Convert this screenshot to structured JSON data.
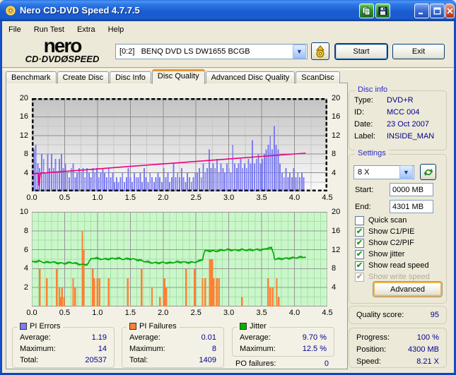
{
  "window": {
    "title": "Nero CD-DVD Speed 4.7.7.5"
  },
  "titlebar": {
    "buttons": [
      {
        "name": "copy-to-clipboard-button",
        "icon": "copy-icon"
      },
      {
        "name": "save-screenshot-button",
        "icon": "floppy-disk-icon"
      },
      {
        "name": "minimize-button",
        "icon": "minimize-icon"
      },
      {
        "name": "maximize-button",
        "icon": "maximize-icon"
      },
      {
        "name": "close-button",
        "icon": "close-icon"
      }
    ]
  },
  "menu": {
    "items": [
      "File",
      "Run Test",
      "Extra",
      "Help"
    ]
  },
  "header": {
    "logo_line1": "nero",
    "logo_line2": "CD·DVDØSPEED",
    "drive": "[0:2]   BENQ DVD LS DW1655 BCGB",
    "eject_icon": "eject-disc-icon",
    "start_label": "Start",
    "exit_label": "Exit"
  },
  "tabs": {
    "items": [
      "Benchmark",
      "Create Disc",
      "Disc Info",
      "Disc Quality",
      "Advanced Disc Quality",
      "ScanDisc"
    ],
    "active": "Disc Quality"
  },
  "disc_info": {
    "title": "Disc info",
    "rows": [
      {
        "label": "Type:",
        "value": "DVD+R"
      },
      {
        "label": "ID:",
        "value": "MCC 004"
      },
      {
        "label": "Date:",
        "value": "23 Oct 2007"
      },
      {
        "label": "Label:",
        "value": "INSIDE_MAN"
      }
    ]
  },
  "settings": {
    "title": "Settings",
    "speed": "8 X",
    "refresh_icon": "refresh-icon",
    "start_label": "Start:",
    "start_value": "0000 MB",
    "end_label": "End:",
    "end_value": "4301 MB",
    "checkboxes": [
      {
        "label": "Quick scan",
        "checked": false,
        "disabled": false
      },
      {
        "label": "Show C1/PIE",
        "checked": true,
        "disabled": false
      },
      {
        "label": "Show C2/PIF",
        "checked": true,
        "disabled": false
      },
      {
        "label": "Show jitter",
        "checked": true,
        "disabled": false
      },
      {
        "label": "Show read speed",
        "checked": true,
        "disabled": false
      },
      {
        "label": "Show write speed",
        "checked": true,
        "disabled": true
      }
    ],
    "advanced_label": "Advanced"
  },
  "quality": {
    "label": "Quality score:",
    "value": "95"
  },
  "progress": {
    "rows": [
      {
        "label": "Progress:",
        "value": "100 %"
      },
      {
        "label": "Position:",
        "value": "4300 MB"
      },
      {
        "label": "Speed:",
        "value": "8.21 X"
      }
    ]
  },
  "stats": {
    "boxes": [
      {
        "title": "PI Errors",
        "color": "#7d7df2",
        "rows": [
          {
            "label": "Average:",
            "value": "1.19"
          },
          {
            "label": "Maximum:",
            "value": "14"
          },
          {
            "label": "Total:",
            "value": "20537"
          }
        ]
      },
      {
        "title": "PI Failures",
        "color": "#ff8033",
        "rows": [
          {
            "label": "Average:",
            "value": "0.01"
          },
          {
            "label": "Maximum:",
            "value": "8"
          },
          {
            "label": "Total:",
            "value": "1409"
          }
        ]
      },
      {
        "title": "Jitter",
        "color": "#00b400",
        "rows": [
          {
            "label": "Average:",
            "value": "9.70 %"
          },
          {
            "label": "Maximum:",
            "value": "12.5 %"
          }
        ]
      }
    ],
    "po_label": "PO failures:",
    "po_value": "0"
  },
  "chart_data": [
    {
      "type": "bar",
      "name": "pi-errors-and-read-speed",
      "x_axis": {
        "range": [
          0,
          4.5
        ],
        "tick_step": 0.5,
        "tick_labels": [
          "0.0",
          "0.5",
          "1.0",
          "1.5",
          "2.0",
          "2.5",
          "3.0",
          "3.5",
          "4.0",
          "4.5"
        ]
      },
      "y_axis_left": {
        "range": [
          0,
          20
        ],
        "ticks": [
          {
            "v": 4,
            "t": "4"
          },
          {
            "v": 8,
            "t": "8"
          },
          {
            "v": 12,
            "t": "12"
          },
          {
            "v": 16,
            "t": "16"
          },
          {
            "v": 20,
            "t": "20"
          }
        ]
      },
      "y_axis_right": {
        "range": [
          0,
          20
        ],
        "ticks": [
          {
            "v": 4,
            "t": "4"
          },
          {
            "v": 8,
            "t": "8"
          },
          {
            "v": 12,
            "t": "12"
          },
          {
            "v": 16,
            "t": "16"
          },
          {
            "v": 20,
            "t": "20"
          }
        ]
      },
      "background": {
        "type": "gradient",
        "from": "#c3c3c3",
        "to": "#fbfbfb"
      },
      "series": [
        {
          "name": "PI Errors",
          "type": "bar",
          "color": "#7d7df2",
          "x_start": 0,
          "x_step": 0.03,
          "values": [
            5,
            9,
            10,
            6,
            5,
            8,
            7,
            4,
            8,
            5,
            8,
            5,
            7,
            4,
            7,
            8,
            5,
            6,
            4,
            3,
            5,
            6,
            3,
            4,
            5,
            4,
            5,
            3,
            5,
            4,
            3,
            5,
            4,
            5,
            3,
            4,
            5,
            4,
            3,
            5,
            3,
            4,
            2,
            3,
            2,
            3,
            4,
            2,
            3,
            5,
            3,
            2,
            4,
            3,
            3,
            4,
            2,
            5,
            3,
            2,
            4,
            3,
            2,
            3,
            4,
            3,
            2,
            5,
            3,
            4,
            2,
            3,
            6,
            3,
            4,
            3,
            5,
            3,
            2,
            4,
            3,
            2,
            3,
            4,
            4,
            5,
            3,
            6,
            4,
            5,
            9,
            5,
            6,
            5,
            7,
            4,
            6,
            5,
            4,
            6,
            5,
            4,
            10,
            6,
            5,
            6,
            7,
            5,
            6,
            5,
            7,
            6,
            11,
            6,
            7,
            8,
            6,
            7,
            8,
            9,
            10,
            12,
            9,
            14,
            10,
            9,
            6,
            4,
            3,
            5,
            3,
            4,
            3,
            5,
            3,
            4,
            3,
            4,
            3
          ]
        },
        {
          "name": "Read speed",
          "type": "line",
          "color": "#ee0080",
          "points": [
            [
              0,
              3.75
            ],
            [
              0.1,
              3.86
            ],
            [
              0.11,
              1.2
            ],
            [
              0.13,
              3.9
            ],
            [
              0.5,
              4.29
            ],
            [
              1,
              4.82
            ],
            [
              1.5,
              5.36
            ],
            [
              2,
              5.89
            ],
            [
              2.5,
              6.43
            ],
            [
              3,
              6.96
            ],
            [
              3.5,
              7.5
            ],
            [
              3.7,
              7.71
            ],
            [
              4,
              8.03
            ],
            [
              4.17,
              8.2
            ]
          ]
        }
      ]
    },
    {
      "type": "line",
      "name": "jitter-and-pi-failures",
      "x_axis": {
        "range": [
          0,
          4.5
        ],
        "tick_step": 0.5,
        "tick_labels": [
          "0.0",
          "0.5",
          "1.0",
          "1.5",
          "2.0",
          "2.5",
          "3.0",
          "3.5",
          "4.0",
          "4.5"
        ]
      },
      "y_axis_left": {
        "range": [
          0,
          10
        ],
        "ticks": [
          {
            "v": 2,
            "t": "2"
          },
          {
            "v": 4,
            "t": "4"
          },
          {
            "v": 6,
            "t": "6"
          },
          {
            "v": 8,
            "t": "8"
          },
          {
            "v": 10,
            "t": "10"
          }
        ]
      },
      "y_axis_right": {
        "range": [
          0,
          20
        ],
        "ticks": [
          {
            "v": 4,
            "t": "4"
          },
          {
            "v": 8,
            "t": "8"
          },
          {
            "v": 12,
            "t": "12"
          },
          {
            "v": 16,
            "t": "16"
          },
          {
            "v": 20,
            "t": "20"
          }
        ]
      },
      "background": {
        "type": "solid",
        "color": "#c9f7c9"
      },
      "series": [
        {
          "name": "PI Failures",
          "type": "spike",
          "color": "#ff8033",
          "points": [
            [
              0.12,
              4
            ],
            [
              0.23,
              3
            ],
            [
              0.38,
              4
            ],
            [
              0.42,
              2
            ],
            [
              0.44,
              1
            ],
            [
              0.46,
              2
            ],
            [
              0.49,
              1
            ],
            [
              0.63,
              3
            ],
            [
              0.66,
              2
            ],
            [
              0.77,
              8
            ],
            [
              0.79,
              6
            ],
            [
              0.93,
              4
            ],
            [
              0.95,
              3
            ],
            [
              1.0,
              3
            ],
            [
              1.03,
              3
            ],
            [
              1.17,
              3
            ],
            [
              1.46,
              3
            ],
            [
              1.67,
              4
            ],
            [
              1.83,
              2
            ],
            [
              1.95,
              1
            ],
            [
              2.02,
              3
            ],
            [
              2.05,
              2
            ],
            [
              2.35,
              4
            ],
            [
              2.48,
              4
            ],
            [
              2.6,
              3
            ],
            [
              2.64,
              3
            ],
            [
              2.71,
              5
            ],
            [
              2.73,
              5
            ],
            [
              2.75,
              5
            ],
            [
              2.77,
              3
            ],
            [
              2.82,
              3
            ],
            [
              2.85,
              3
            ],
            [
              3.2,
              1
            ],
            [
              3.6,
              3
            ],
            [
              3.63,
              2
            ],
            [
              3.67,
              2
            ],
            [
              3.73,
              3
            ],
            [
              3.76,
              1
            ]
          ]
        },
        {
          "name": "Jitter",
          "type": "line",
          "color": "#00a800",
          "noise": true,
          "points": [
            [
              0,
              4.7
            ],
            [
              0.1,
              4.8
            ],
            [
              0.2,
              4.65
            ],
            [
              0.3,
              4.7
            ],
            [
              0.4,
              4.6
            ],
            [
              0.5,
              4.55
            ],
            [
              0.6,
              4.65
            ],
            [
              0.7,
              4.5
            ],
            [
              0.8,
              4.4
            ],
            [
              0.85,
              4.5
            ],
            [
              0.9,
              5.0
            ],
            [
              0.95,
              5.15
            ],
            [
              1.0,
              5.05
            ],
            [
              1.1,
              5.0
            ],
            [
              1.2,
              5.05
            ],
            [
              1.3,
              5.1
            ],
            [
              1.4,
              5.0
            ],
            [
              1.5,
              5.05
            ],
            [
              1.6,
              4.95
            ],
            [
              1.7,
              4.8
            ],
            [
              1.8,
              4.65
            ],
            [
              1.9,
              4.6
            ],
            [
              2.0,
              4.65
            ],
            [
              2.1,
              4.6
            ],
            [
              2.2,
              4.7
            ],
            [
              2.3,
              4.7
            ],
            [
              2.4,
              4.65
            ],
            [
              2.5,
              4.7
            ],
            [
              2.55,
              4.8
            ],
            [
              2.6,
              5.0
            ],
            [
              2.63,
              5.85
            ],
            [
              2.7,
              5.9
            ],
            [
              2.8,
              5.85
            ],
            [
              2.9,
              5.95
            ],
            [
              3.0,
              6.0
            ],
            [
              3.1,
              5.95
            ],
            [
              3.2,
              6.0
            ],
            [
              3.3,
              5.95
            ],
            [
              3.4,
              6.0
            ],
            [
              3.5,
              6.0
            ],
            [
              3.55,
              6.05
            ],
            [
              3.6,
              6.2
            ],
            [
              3.65,
              6.15
            ],
            [
              3.68,
              5.6
            ],
            [
              3.7,
              5.0
            ],
            [
              3.8,
              5.05
            ],
            [
              3.9,
              5.1
            ],
            [
              4.0,
              5.15
            ],
            [
              4.1,
              5.2
            ],
            [
              4.17,
              5.25
            ]
          ]
        }
      ]
    }
  ]
}
